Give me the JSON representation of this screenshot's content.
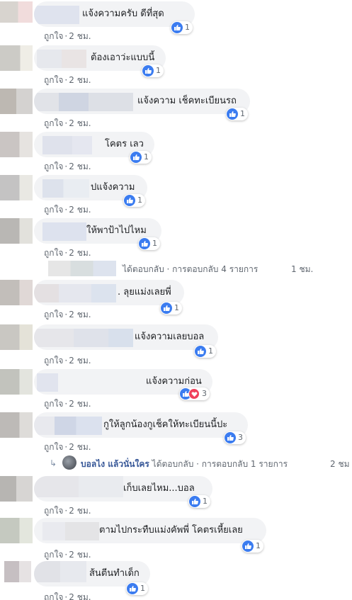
{
  "meta": {
    "like_label": "ถูกใจ",
    "sep": "·",
    "time": "2 ชม."
  },
  "comments": [
    {
      "text": "แจ้งความครับ ดีที่สุด",
      "count": "1"
    },
    {
      "text": "ต้องเอาว่ะแบบนี้",
      "count": "1"
    },
    {
      "text": "แจ้งความ เช็คทะเบียนรถ",
      "count": "1"
    },
    {
      "text": "โคตร เลว",
      "count": "1"
    },
    {
      "text": "ปแจ้งความ",
      "count": "1"
    },
    {
      "text": "ให้พาป้าไปไหม",
      "count": "1"
    },
    {
      "text": ". ลุยแม่งเลยพี่",
      "count": "1"
    },
    {
      "text": "แจ้งความเลยบอล",
      "count": "1"
    },
    {
      "text": "แจ้งความก่อน",
      "count": "3"
    },
    {
      "text": "กูให้ลูกน้องกูเช็คให้ทะเบียนนี้ปะ",
      "count": "3"
    },
    {
      "text": "เก็บเลยไหม...บอล",
      "count": "1"
    },
    {
      "text": "ตามไปกระทืบแม่งคัพพี่ โคตรเหี้ยเลย",
      "count": "1"
    },
    {
      "text": "ส้นตีนทำเด็ก",
      "count": "1"
    }
  ],
  "reply1": {
    "text": "ได้ตอบกลับ · การตอบกลับ 4 รายการ",
    "time": "1 ชม."
  },
  "reply2": {
    "name": "บอลไง แล้วนั่นใคร",
    "text": "ได้ตอบกลับ · การตอบกลับ 1 รายการ",
    "time": "2 ชม"
  },
  "icons": {
    "like": "thumbs-up-icon",
    "love": "heart-icon",
    "reply": "reply-arrow-icon"
  },
  "colors": {
    "like_blue": "#3b7cf0",
    "love_red": "#f0405c",
    "bubble": "#f2f3f5",
    "meta": "#606770",
    "link": "#385898"
  }
}
